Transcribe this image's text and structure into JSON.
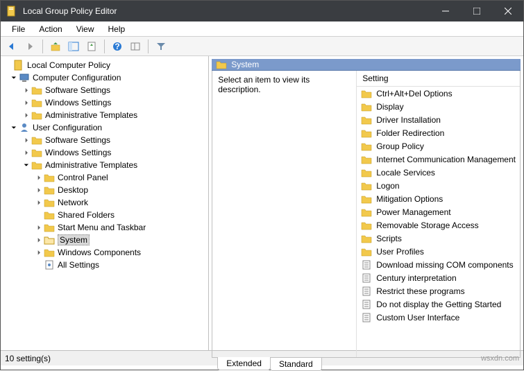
{
  "window": {
    "title": "Local Group Policy Editor"
  },
  "menu": {
    "file": "File",
    "action": "Action",
    "view": "View",
    "help": "Help"
  },
  "tree": {
    "root": "Local Computer Policy",
    "cc": "Computer Configuration",
    "cc_sw": "Software Settings",
    "cc_win": "Windows Settings",
    "cc_adm": "Administrative Templates",
    "uc": "User Configuration",
    "uc_sw": "Software Settings",
    "uc_win": "Windows Settings",
    "uc_adm": "Administrative Templates",
    "cp": "Control Panel",
    "dk": "Desktop",
    "nw": "Network",
    "sf": "Shared Folders",
    "st": "Start Menu and Taskbar",
    "sys": "System",
    "wc": "Windows Components",
    "all": "All Settings"
  },
  "panel": {
    "title": "System",
    "desc": "Select an item to view its description.",
    "setting_header": "Setting"
  },
  "settings": {
    "s0": "Ctrl+Alt+Del Options",
    "s1": "Display",
    "s2": "Driver Installation",
    "s3": "Folder Redirection",
    "s4": "Group Policy",
    "s5": "Internet Communication Management",
    "s6": "Locale Services",
    "s7": "Logon",
    "s8": "Mitigation Options",
    "s9": "Power Management",
    "s10": "Removable Storage Access",
    "s11": "Scripts",
    "s12": "User Profiles",
    "p0": "Download missing COM components",
    "p1": "Century interpretation",
    "p2": "Restrict these programs",
    "p3": "Do not display the Getting Started",
    "p4": "Custom User Interface"
  },
  "tabs": {
    "extended": "Extended",
    "standard": "Standard"
  },
  "status": {
    "count": "10 setting(s)",
    "watermark": "wsxdn.com"
  }
}
